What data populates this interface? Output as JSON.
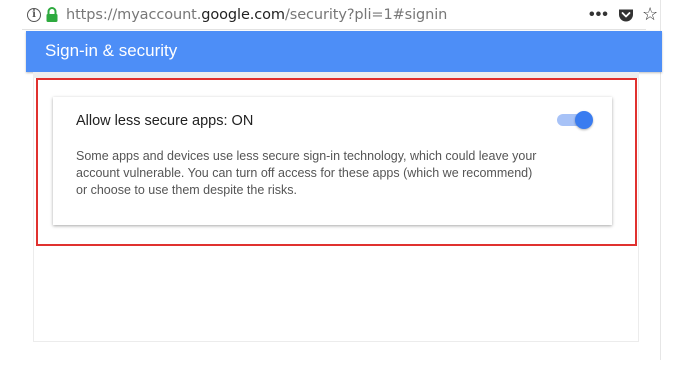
{
  "browser": {
    "url_prefix": "https://myaccount.",
    "url_domain": "google.com",
    "url_path": "/security?pli=1#signin",
    "more_label": "•••",
    "star_glyph": "☆",
    "info_glyph": "i",
    "icons": [
      "info-icon",
      "lock-icon",
      "more-icon",
      "pocket-icon",
      "star-icon"
    ]
  },
  "header": {
    "title": "Sign-in & security",
    "color": "#4d8ef7"
  },
  "card": {
    "title": "Allow less secure apps: ON",
    "description": "Some apps and devices use less secure sign-in technology, which could leave your account vulnerable. You can turn off access for these apps (which we recommend) or choose to use them despite the risks.",
    "toggle_on": true,
    "toggle_color": "#3a7cf0"
  },
  "annotation": {
    "highlight_color": "#e0312f"
  }
}
